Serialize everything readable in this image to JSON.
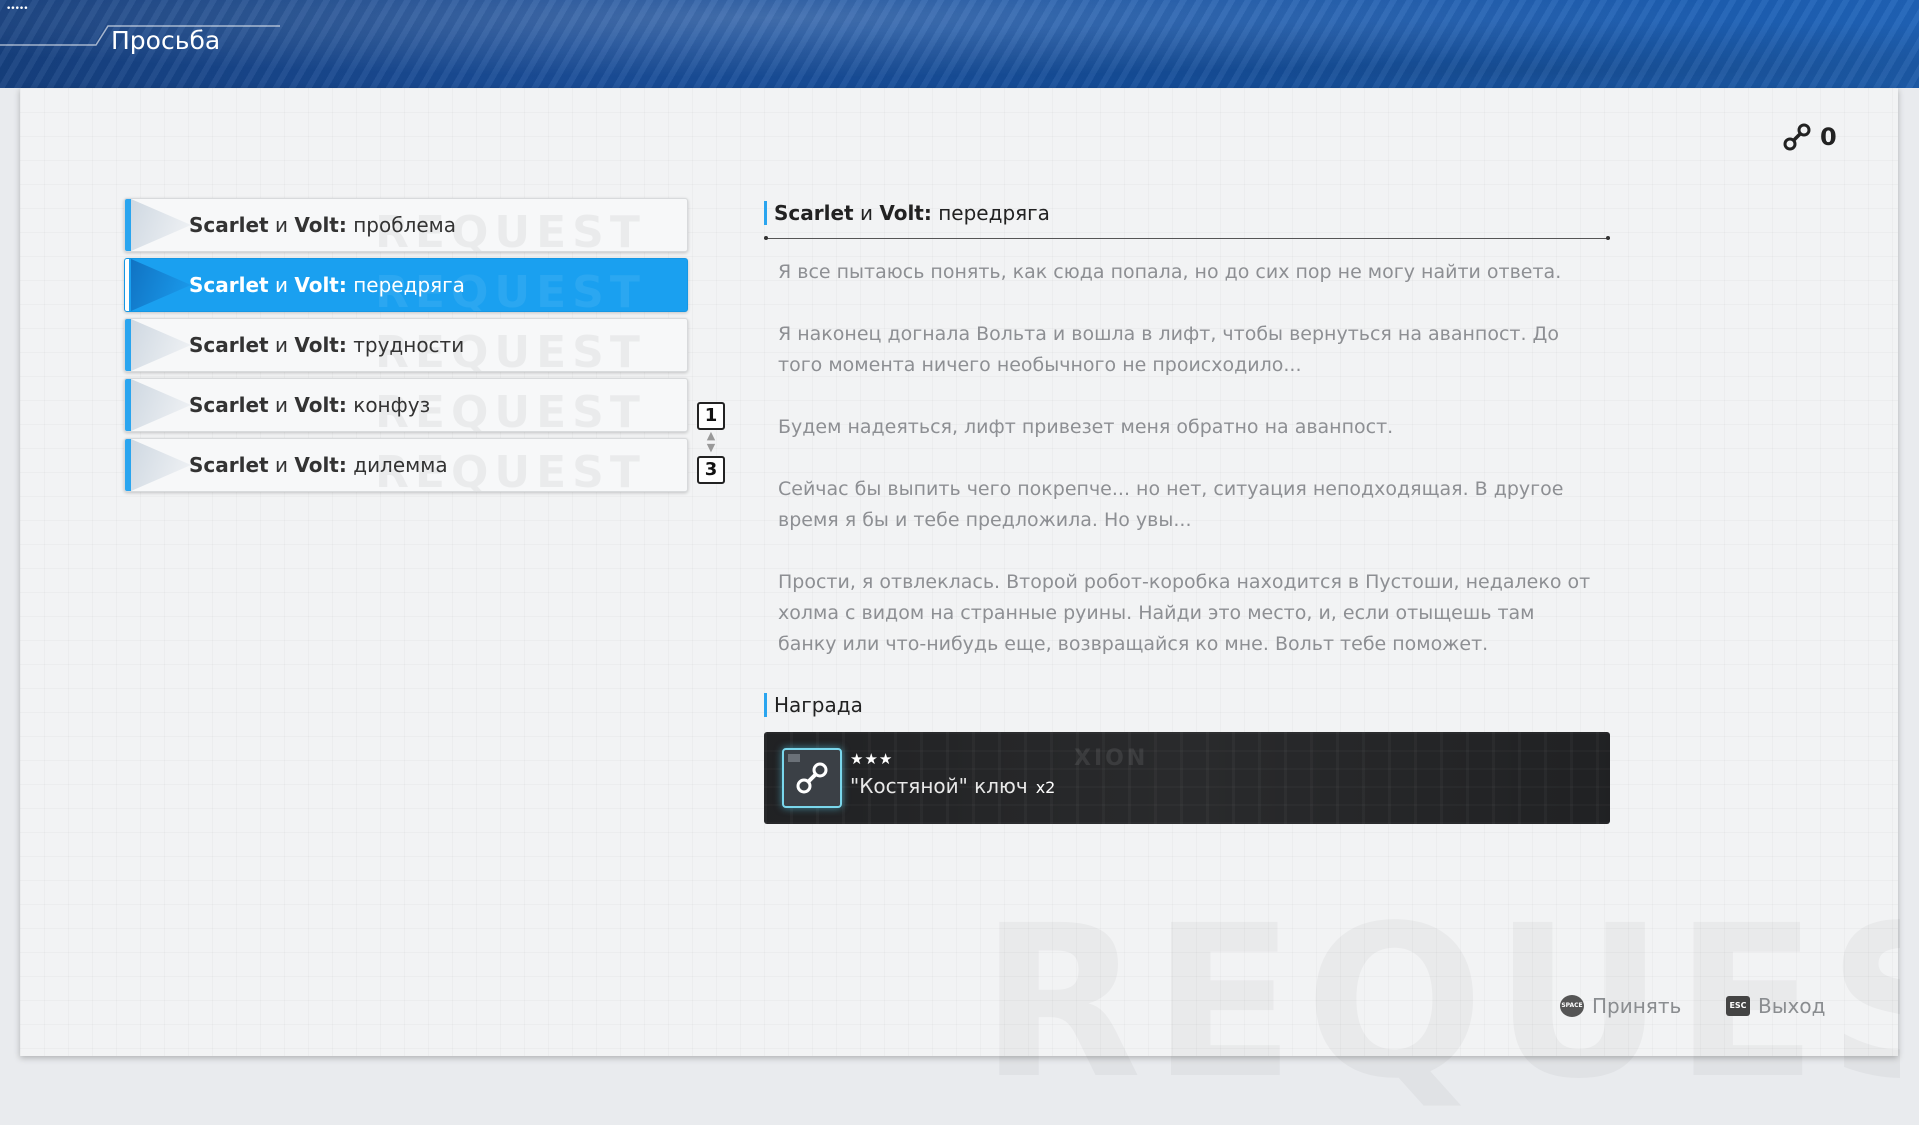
{
  "header": {
    "title": "Просьба",
    "status_dots": "•••••"
  },
  "key_indicator": {
    "icon": "key-icon",
    "value": "0"
  },
  "quests": [
    {
      "name_en": "Scarlet",
      "conj": "и",
      "name2": "Volt:",
      "suffix": "проблема",
      "selected": false
    },
    {
      "name_en": "Scarlet",
      "conj": "и",
      "name2": "Volt:",
      "suffix": "передряга",
      "selected": true
    },
    {
      "name_en": "Scarlet",
      "conj": "и",
      "name2": "Volt:",
      "suffix": "трудности",
      "selected": false
    },
    {
      "name_en": "Scarlet",
      "conj": "и",
      "name2": "Volt:",
      "suffix": "конфуз",
      "selected": false
    },
    {
      "name_en": "Scarlet",
      "conj": "и",
      "name2": "Volt:",
      "suffix": "дилемма",
      "selected": false
    }
  ],
  "list_watermark": "REQUEST",
  "page_indicator": {
    "current": "1",
    "total": "3"
  },
  "detail": {
    "title_bold": "Scarlet",
    "title_conj": "и",
    "title_bold2": "Volt:",
    "title_rest": "передряга",
    "paragraphs": [
      "Я все пытаюсь понять, как сюда попала, но до сих пор не могу найти ответа.",
      "Я наконец догнала Вольта и вошла в лифт, чтобы вернуться на аванпост. До того момента ничего необычного не происходило...",
      "Будем надеяться, лифт привезет меня обратно на аванпост.",
      "Сейчас бы выпить чего покрепче... но  нет, ситуация неподходящая. В другое время я бы и тебе предложила. Но увы...",
      "Прости, я отвлеклась. Второй робот-коробка находится в Пустоши, недалеко от холма с видом на странные руины. Найди это место, и, если отыщешь там банку или что-нибудь еще, возвращайся ко мне. Вольт тебе поможет."
    ]
  },
  "reward": {
    "title": "Награда",
    "stars": "★★★",
    "item_name": "\"Костяной\" ключ",
    "quantity": "x2",
    "card_watermark": "XION",
    "icon": "bone-key-icon"
  },
  "footer": {
    "accept_key": "SPACE",
    "accept_label": "Принять",
    "exit_key": "ESC",
    "exit_label": "Выход"
  },
  "panel_watermark": "REQUEST",
  "colors": {
    "accent": "#1aa0f0",
    "header_blue": "#1a4e9a",
    "reward_bg": "#1c1d1f",
    "icon_glow": "#7ad7ec"
  }
}
